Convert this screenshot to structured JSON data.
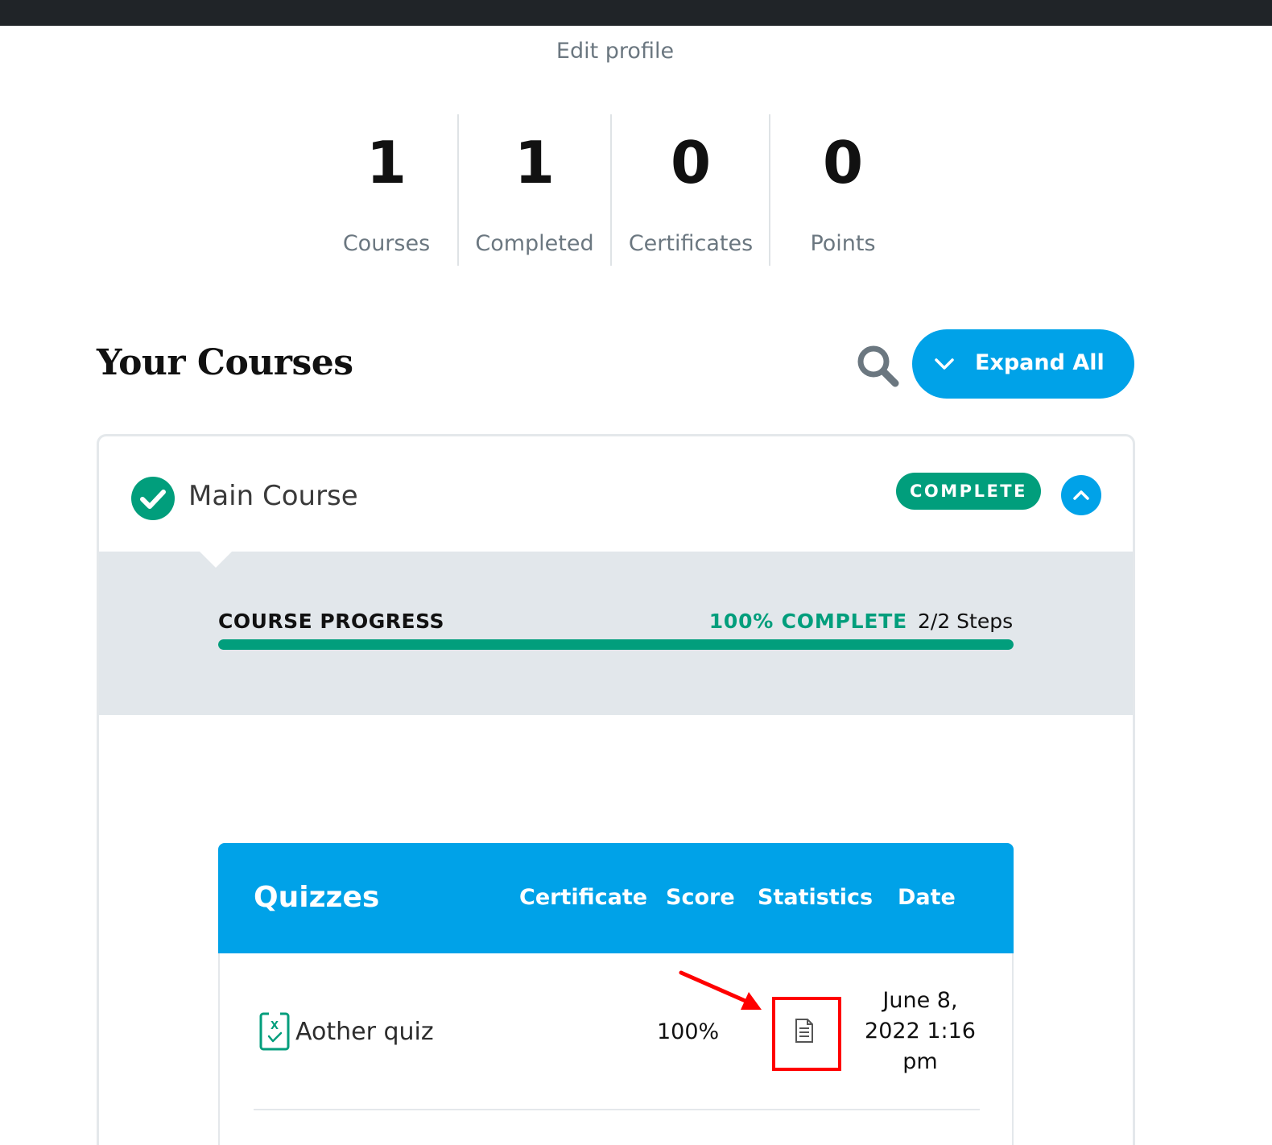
{
  "header": {
    "edit_profile": "Edit profile"
  },
  "stats": [
    {
      "value": "1",
      "label": "Courses"
    },
    {
      "value": "1",
      "label": "Completed"
    },
    {
      "value": "0",
      "label": "Certificates"
    },
    {
      "value": "0",
      "label": "Points"
    }
  ],
  "section": {
    "title": "Your Courses",
    "search_icon": "search-icon",
    "expand_label": "Expand All"
  },
  "course": {
    "name": "Main Course",
    "status_badge": "COMPLETE",
    "progress": {
      "title": "COURSE PROGRESS",
      "percent_label": "100% COMPLETE",
      "steps_label": "2/2 Steps",
      "fraction": 1.0
    },
    "quizzes": {
      "title": "Quizzes",
      "columns": [
        "Certificate",
        "Score",
        "Statistics",
        "Date"
      ],
      "rows": [
        {
          "name": "Aother quiz",
          "certificate": "",
          "score": "100%",
          "statistics_icon": "document-icon",
          "date_line1": "June 8,",
          "date_line2": "2022 1:16",
          "date_line3": "pm"
        }
      ]
    }
  },
  "colors": {
    "accent_blue": "#00a2e8",
    "complete_green": "#019e7c",
    "topbar": "#202428",
    "annotation_red": "#ff0000"
  }
}
